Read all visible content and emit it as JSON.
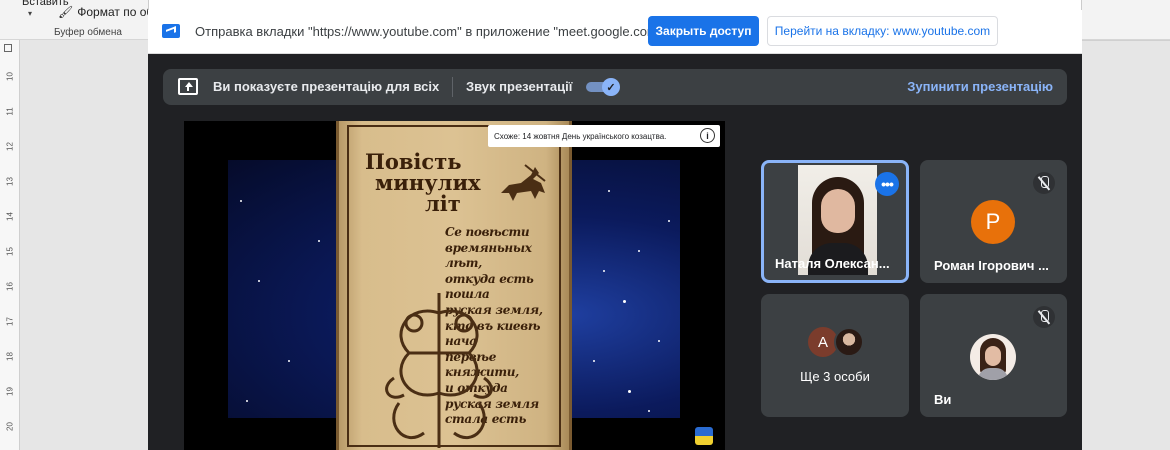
{
  "word": {
    "paste_label": "Вставить",
    "format_label": "Формат по обр",
    "clipboard_label": "Буфер обмена",
    "ruler_ticks": [
      "10",
      "11",
      "12",
      "13",
      "14",
      "15",
      "16",
      "17",
      "18",
      "19",
      "20"
    ]
  },
  "chrome": {
    "share_text": "Отправка вкладки \"https://www.youtube.com\" в приложение \"meet.google.com\"...",
    "stop_sharing_label": "Закрыть доступ",
    "go_to_tab_label": "Перейти на вкладку: www.youtube.com"
  },
  "meet": {
    "presenting_text": "Ви показуєте презентацію для всіх",
    "sound_label": "Звук презентації",
    "sound_enabled": true,
    "stop_presenting_label": "Зупинити презентацію",
    "video": {
      "tooltip_text": "Схоже: 14 жовтня День українського козацтва.",
      "book_title": [
        "Повість",
        "минулих",
        "літ"
      ],
      "book_lines": [
        "Се повѣсти",
        "времяньных лѣт,",
        "откуда есть пошла",
        "руская земля,",
        "кто въ киевѣ нача",
        "первѣе княжити,",
        "и откуда",
        "руская земля",
        "стала есть"
      ]
    },
    "participants": [
      {
        "name": "Наталя Олексан...",
        "active": true
      },
      {
        "name": "Роман Ігорович ...",
        "initial": "Р",
        "muted": true
      },
      {
        "name": "Ще 3 особи",
        "initial": "А"
      },
      {
        "name": "Ви",
        "muted": true
      }
    ]
  },
  "colors": {
    "accent": "#1a73e8",
    "meet_bg": "#202124",
    "tile_bg": "#3c4043",
    "link": "#8ab4f8"
  }
}
